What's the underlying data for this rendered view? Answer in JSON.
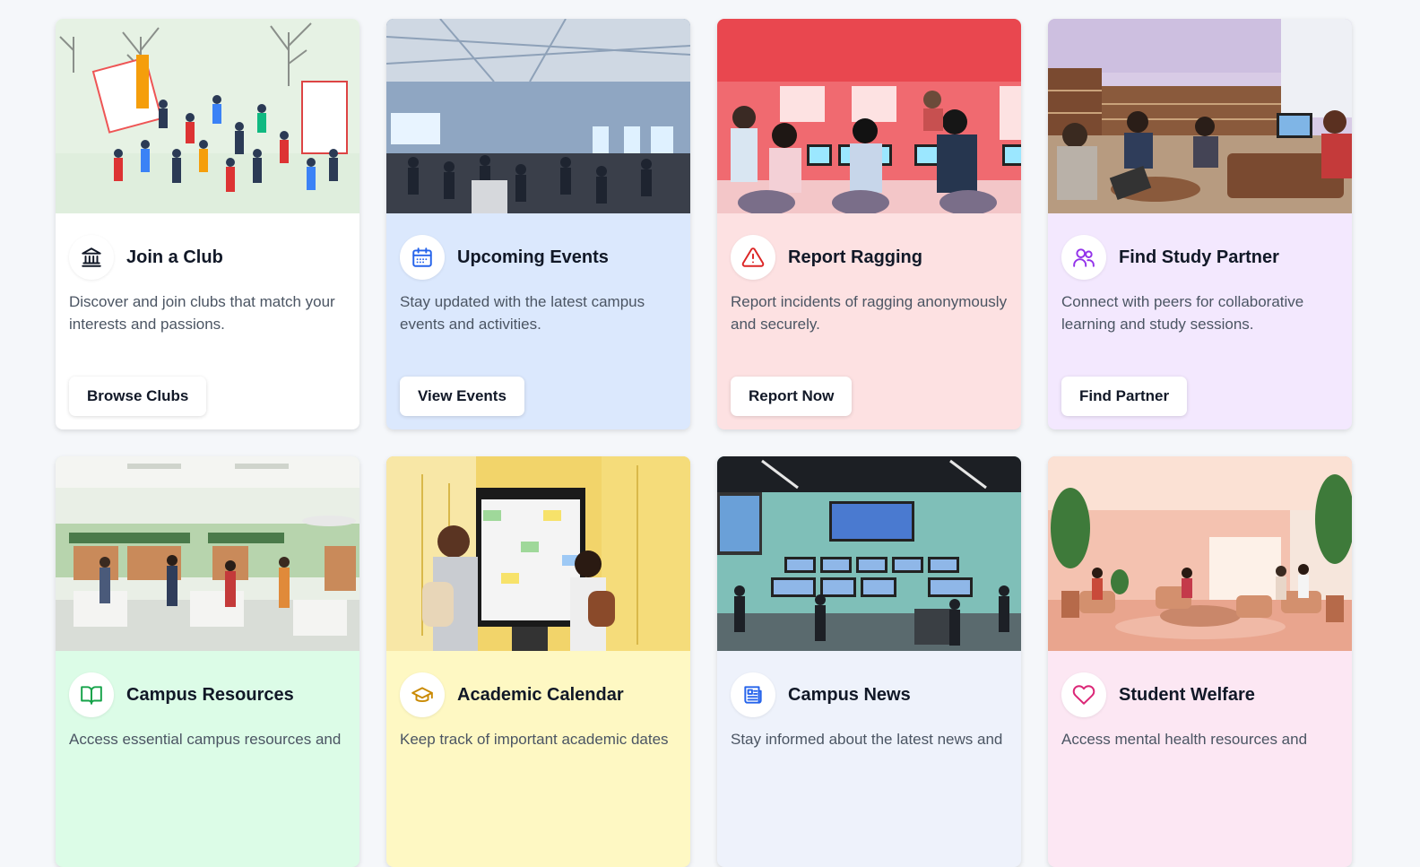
{
  "cards": [
    {
      "title": "Join a Club",
      "desc": "Discover and join clubs that match your interests and passions.",
      "button": "Browse Clubs",
      "icon": "building-icon",
      "icon_color": "#111827"
    },
    {
      "title": "Upcoming Events",
      "desc": "Stay updated with the latest campus events and activities.",
      "button": "View Events",
      "icon": "calendar-icon",
      "icon_color": "#2563eb"
    },
    {
      "title": "Report Ragging",
      "desc": "Report incidents of ragging anonymously and securely.",
      "button": "Report Now",
      "icon": "alert-triangle-icon",
      "icon_color": "#dc2626"
    },
    {
      "title": "Find Study Partner",
      "desc": "Connect with peers for collaborative learning and study sessions.",
      "button": "Find Partner",
      "icon": "users-icon",
      "icon_color": "#9333ea"
    },
    {
      "title": "Campus Resources",
      "desc": "Access essential campus resources and",
      "icon": "book-icon",
      "icon_color": "#16a34a"
    },
    {
      "title": "Academic Calendar",
      "desc": "Keep track of important academic dates",
      "icon": "graduation-cap-icon",
      "icon_color": "#ca8a04"
    },
    {
      "title": "Campus News",
      "desc": "Stay informed about the latest news and",
      "icon": "newspaper-icon",
      "icon_color": "#2563eb"
    },
    {
      "title": "Student Welfare",
      "desc": "Access mental health resources and",
      "icon": "heart-icon",
      "icon_color": "#db2777"
    }
  ]
}
